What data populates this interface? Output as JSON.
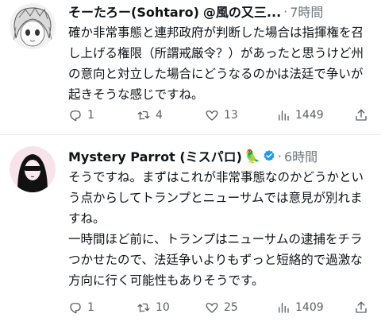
{
  "tweets": [
    {
      "name": "そーたろー(Sohtaro)",
      "handle": "@風の又三...",
      "time": "7時間",
      "body": "確か非常事態と連邦政府が判断した場合は指揮権を召し上げる権限（所謂戒厳令？）があったと思うけど州の意向と対立した場合にどうなるのかは法廷で争いが起きそうな感じですね。",
      "replies": "1",
      "retweets": "4",
      "likes": "13",
      "views": "1449"
    },
    {
      "name": "Mystery Parrot (ミスパロ)",
      "emoji": "🦜",
      "time": "6時間",
      "body": "そうですね。まずはこれが非常事態なのかどうかという点からしてトランプとニューサムでは意見が別れますね。\n一時間ほど前に、トランプはニューサムの逮捕をチラつかせたので、法廷争いよりもずっと短絡的で過激な方向に行く可能性もありそうです。",
      "replies": "1",
      "retweets": "10",
      "likes": "25",
      "views": "1409"
    }
  ],
  "colors": {
    "text": "#0f1419",
    "muted": "#6e767d",
    "verified": "#1d9bf0"
  }
}
